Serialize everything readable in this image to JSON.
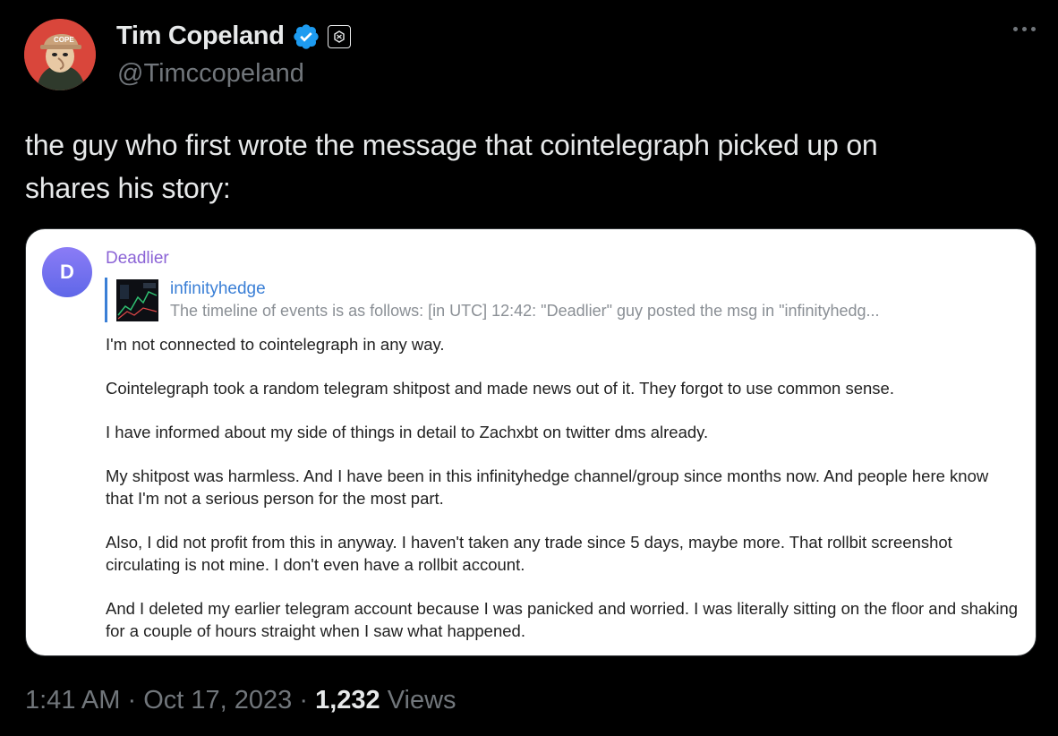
{
  "author": {
    "display_name": "Tim Copeland",
    "handle": "@Timccopeland",
    "avatar_text": "COPE"
  },
  "tweet": {
    "text_line1": "the guy who first wrote the message that cointelegraph picked up on",
    "text_line2": "shares his story:"
  },
  "telegram": {
    "avatar_letter": "D",
    "sender": "Deadlier",
    "reply": {
      "title": "infinityhedge",
      "snippet": "The timeline of events is as follows: [in UTC]  12:42: \"Deadlier\" guy posted the msg in \"infinityhedg..."
    },
    "paragraphs": [
      "I'm not connected to cointelegraph in any way.",
      "Cointelegraph took a random telegram shitpost and made news out of it. They forgot to use common sense.",
      "I have informed about my side of things in detail to Zachxbt on twitter dms already.",
      "My shitpost was harmless. And I have been in this infinityhedge channel/group since months now. And people here know that I'm not a serious person for the most part.",
      "Also, I did not profit from this in anyway. I haven't taken any trade since 5 days, maybe more. That rollbit screenshot circulating is not mine. I don't even have a rollbit account.",
      "And I deleted my earlier telegram account because I was panicked and worried. I was literally sitting on the floor and shaking for a couple of hours straight when I saw what happened."
    ]
  },
  "meta": {
    "time": "1:41 AM",
    "separator": "·",
    "date": "Oct 17, 2023",
    "views_count": "1,232",
    "views_label": "Views"
  },
  "colors": {
    "verified_blue": "#1d9bf0",
    "telegram_sender": "#8b63d6",
    "telegram_link": "#3a7fd6",
    "muted": "#71767b"
  }
}
